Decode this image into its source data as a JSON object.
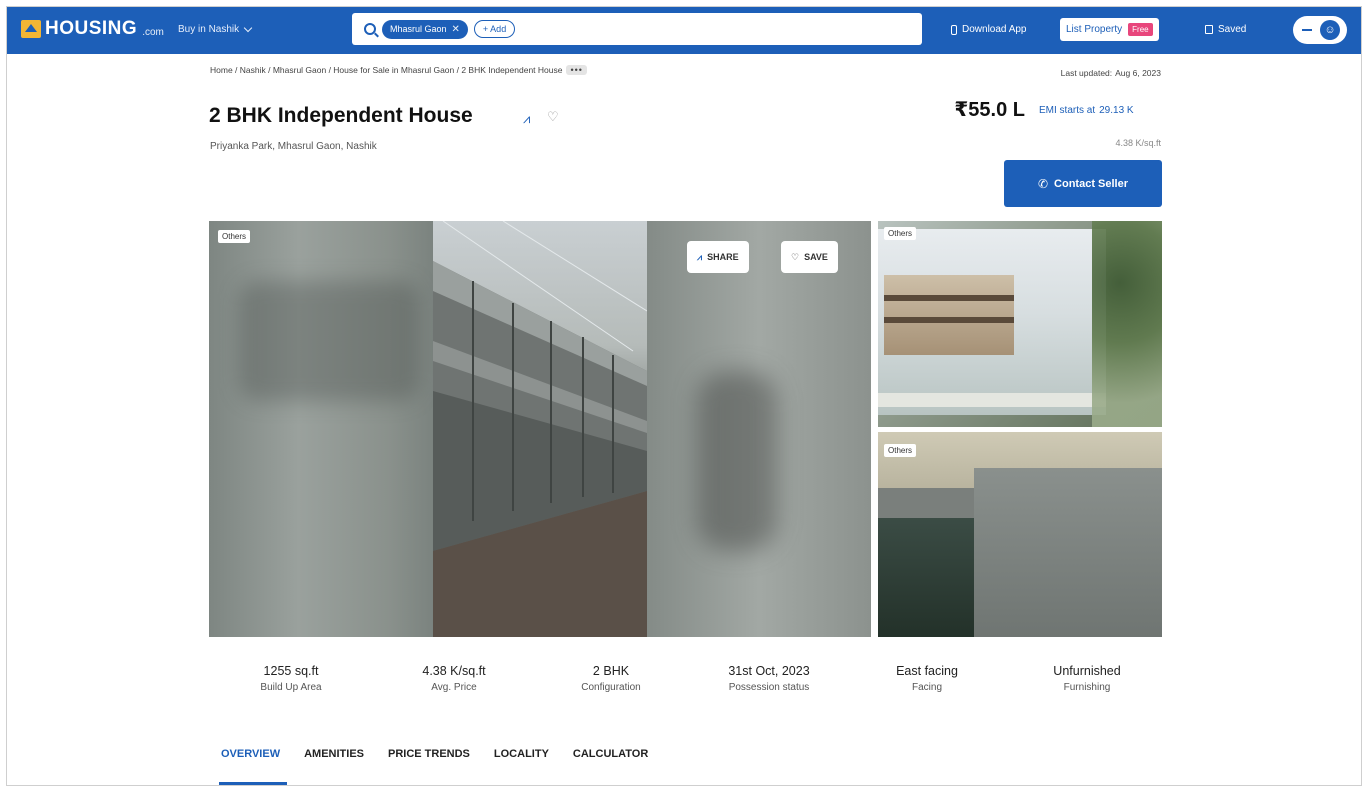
{
  "header": {
    "logo_text": "HOUSING",
    "logo_suffix": ".com",
    "city_select": "Buy in Nashik",
    "search_chip": "Mhasrul Gaon",
    "add_chip": "+ Add",
    "download_app": "Download App",
    "list_property": "List Property",
    "free_badge": "Free",
    "saved": "Saved"
  },
  "breadcrumb": {
    "path": "Home / Nashik / Mhasrul Gaon / House for Sale in Mhasrul Gaon / 2 BHK Independent House",
    "more": "•••"
  },
  "last_updated": {
    "label": "Last updated:",
    "date": "Aug 6, 2023"
  },
  "listing": {
    "title": "2 BHK Independent House",
    "address": "Priyanka Park, Mhasrul Gaon, Nashik",
    "price": "₹55.0 L",
    "emi_label": "EMI starts at",
    "emi_value": "29.13 K",
    "price_per_sqft": "4.38 K/sq.ft",
    "contact_button": "Contact Seller"
  },
  "photos": {
    "main_tag": "Others",
    "share_button": "SHARE",
    "save_button": "SAVE",
    "side1_tag": "Others",
    "side2_tag": "Others"
  },
  "stats": [
    {
      "value": "1255 sq.ft",
      "label": "Build Up Area"
    },
    {
      "value": "4.38 K/sq.ft",
      "label": "Avg. Price"
    },
    {
      "value": "2 BHK",
      "label": "Configuration"
    },
    {
      "value": "31st Oct, 2023",
      "label": "Possession status"
    },
    {
      "value": "East facing",
      "label": "Facing"
    },
    {
      "value": "Unfurnished",
      "label": "Furnishing"
    }
  ],
  "tabs": [
    {
      "label": "OVERVIEW",
      "active": true
    },
    {
      "label": "AMENITIES",
      "active": false
    },
    {
      "label": "PRICE TRENDS",
      "active": false
    },
    {
      "label": "LOCALITY",
      "active": false
    },
    {
      "label": "CALCULATOR",
      "active": false
    }
  ],
  "colors": {
    "brand_blue": "#1d5fb8",
    "logo_yellow": "#f3b634",
    "free_pink": "#e8467c"
  },
  "icons": [
    "logo-icon",
    "chevron-down-icon",
    "search-icon",
    "close-icon",
    "phone-icon",
    "bookmark-icon",
    "menu-icon",
    "avatar-icon",
    "share-icon",
    "heart-icon",
    "call-icon"
  ]
}
